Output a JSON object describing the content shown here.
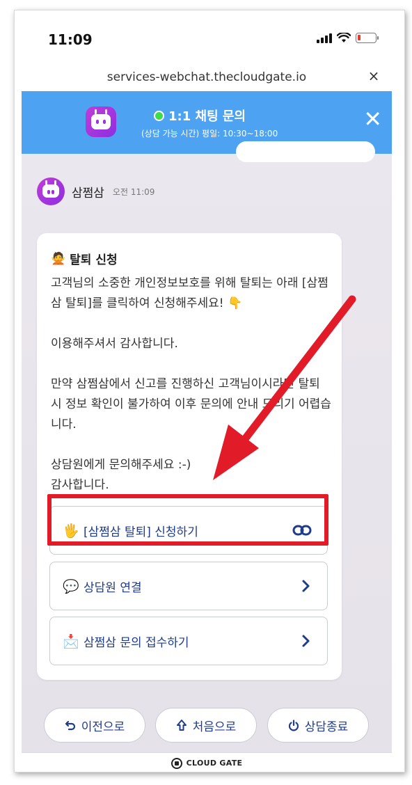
{
  "status_bar": {
    "time": "11:09"
  },
  "browser": {
    "url": "services-webchat.thecloudgate.io",
    "close_glyph": "×"
  },
  "header": {
    "title": "1:1 채팅 문의",
    "subtitle": "(상담 가능 시간) 평일: 10:30~18:00",
    "close_glyph": "✕",
    "status_color": "#3ddc4a",
    "bg_color": "#4da3f2"
  },
  "message": {
    "sender": "삼쩜삼",
    "time": "오전 11:09",
    "title_icon": "🙅",
    "title": "탈퇴 신청",
    "paragraphs": [
      "고객님의 소중한 개인정보보호를 위해 탈퇴는 아래 [삼쩜삼 탈퇴]를 클릭하여 신청해주세요! 👇",
      "이용해주셔서 감사합니다.",
      "만약 삼쩜삼에서 신고를 진행하신 고객님이시라면 탈퇴 시 정보 확인이 불가하여 이후 문의에 안내 드리기 어렵습니다.",
      "상담원에게 문의해주세요 :-)\n감사합니다."
    ]
  },
  "actions": [
    {
      "icon": "🖐",
      "label": "[삼쩜삼 탈퇴] 신청하기",
      "right_icon": "link-icon"
    },
    {
      "icon": "💬",
      "label": "상담원 연결",
      "right_icon": "chevron-right-icon"
    },
    {
      "icon": "📩",
      "label": "삼쩜삼 문의 접수하기",
      "right_icon": "chevron-right-icon"
    }
  ],
  "nav": {
    "back": "이전으로",
    "home": "처음으로",
    "end": "상담종료"
  },
  "footer": {
    "brand": "CLOUD GATE"
  },
  "annotation": {
    "highlight_color": "#e21b28"
  }
}
